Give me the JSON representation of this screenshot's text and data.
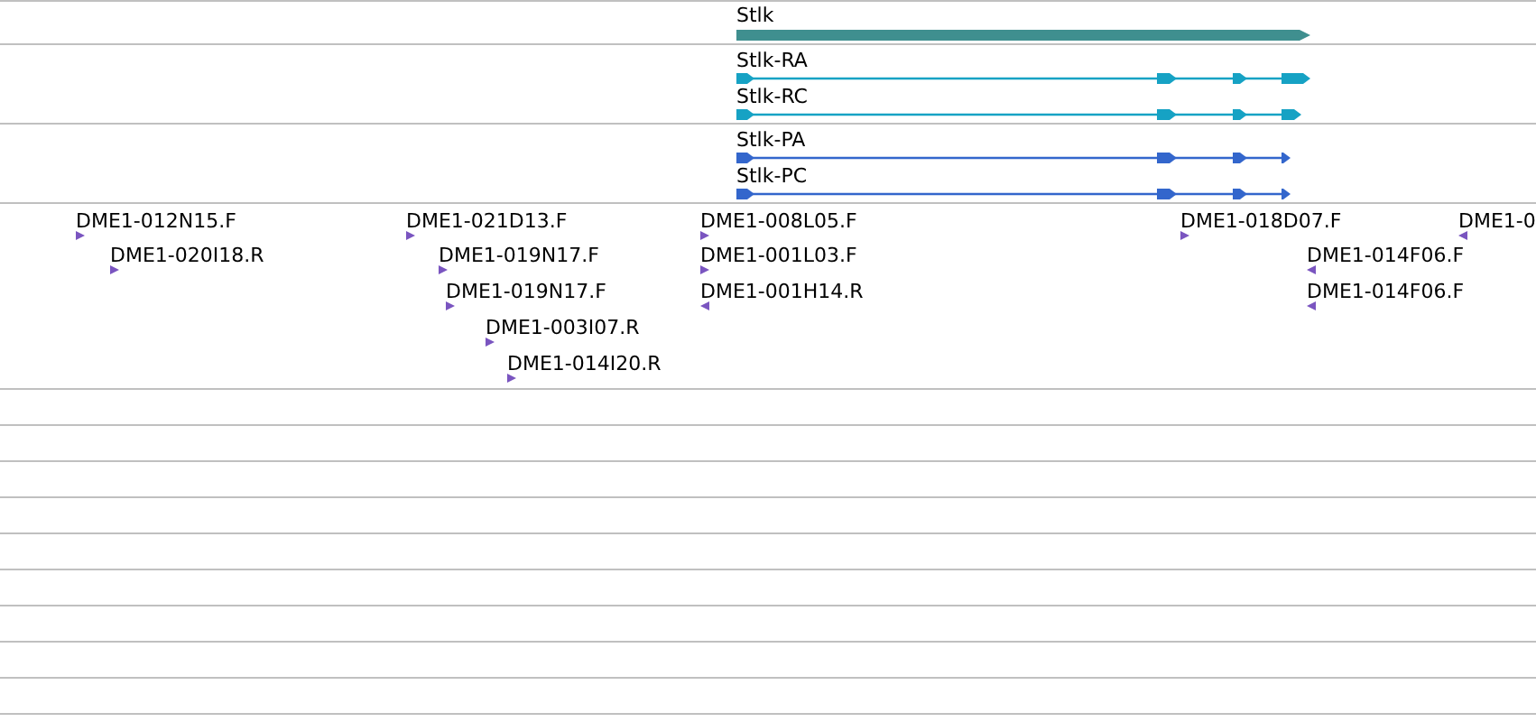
{
  "tracks": [
    {
      "kind": "gene",
      "features": [
        {
          "label": "Stlk"
        }
      ]
    },
    {
      "kind": "transcript",
      "features": [
        {
          "label": "Stlk-RA"
        },
        {
          "label": "Stlk-RC"
        }
      ]
    },
    {
      "kind": "protein",
      "features": [
        {
          "label": "Stlk-PA"
        },
        {
          "label": "Stlk-PC"
        }
      ]
    },
    {
      "kind": "clone",
      "features": [
        {
          "label": "DME1-012N15.F",
          "reverse": false
        },
        {
          "label": "DME1-020I18.R",
          "reverse": false
        },
        {
          "label": "DME1-021D13.F",
          "reverse": false
        },
        {
          "label": "DME1-019N17.F",
          "reverse": false
        },
        {
          "label": "DME1-019N17.F",
          "reverse": false
        },
        {
          "label": "DME1-003I07.R",
          "reverse": false
        },
        {
          "label": "DME1-014I20.R",
          "reverse": false
        },
        {
          "label": "DME1-008L05.F",
          "reverse": false
        },
        {
          "label": "DME1-001L03.F",
          "reverse": false
        },
        {
          "label": "DME1-001H14.R",
          "reverse": true
        },
        {
          "label": "DME1-018D07.F",
          "reverse": false
        },
        {
          "label": "DME1-014F06.F",
          "reverse": true
        },
        {
          "label": "DME1-014F06.F",
          "reverse": true
        },
        {
          "label": "DME1-0",
          "reverse": true
        }
      ]
    }
  ]
}
